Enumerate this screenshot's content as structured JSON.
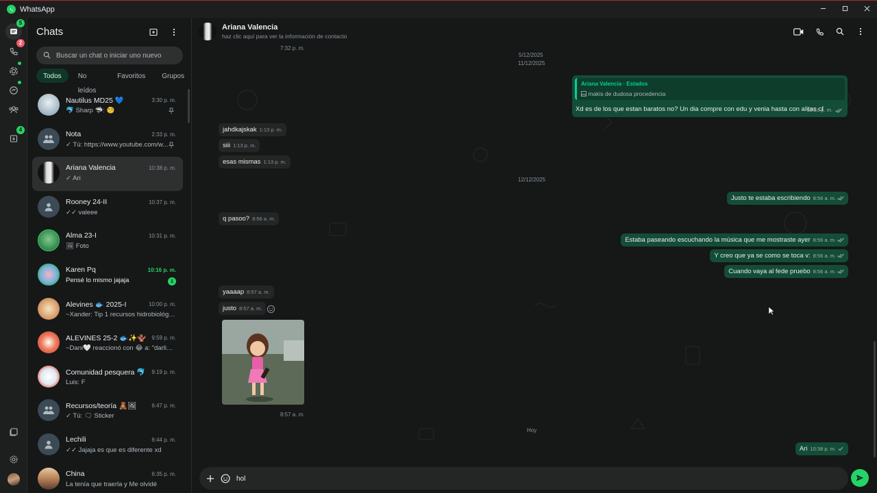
{
  "window": {
    "app_name": "WhatsApp"
  },
  "rail": {
    "chats_badge": "5",
    "calls_badge": "2",
    "communities_badge": "4",
    "badge_color": "#25d366",
    "calls_badge_color": "#f15c6d"
  },
  "chatlist": {
    "title": "Chats",
    "search_placeholder": "Buscar un chat o iniciar uno nuevo",
    "filters": [
      "Todos",
      "No leídos",
      "Favoritos",
      "Grupos"
    ],
    "rows": [
      {
        "name": "Nautilus MD25 💙",
        "time": "3:30 p. m.",
        "preview": "🐬 Sharp 🦈: 🧐",
        "pinned": true
      },
      {
        "name": "Nota",
        "time": "2:33 p. m.",
        "preview": "✓ Tú: https://www.youtube.com/w...",
        "pinned": true
      },
      {
        "name": "Ariana Valencia",
        "time": "10:38 p. m.",
        "preview": "✓ Ari"
      },
      {
        "name": "Rooney 24-II",
        "time": "10:37 p. m.",
        "preview": "✓✓ valeee"
      },
      {
        "name": "Alma 23-I",
        "time": "10:31 p. m.",
        "preview": "🖼 Foto"
      },
      {
        "name": "Karen Pq",
        "time": "10:16 p. m.",
        "preview": "Pensé lo mismo jajaja",
        "unread": "1"
      },
      {
        "name": "Alevines 🐟 2025-I",
        "time": "10:00 p. m.",
        "preview": "~Xander: Tip 1 recursos hidrobiológicos"
      },
      {
        "name": "ALEVINES 25-2 🐟✨🪸",
        "time": "9:59 p. m.",
        "preview": "~Dani🤍 reaccionó con 😂 a: \"darlines\""
      },
      {
        "name": "Comunidad pesquera 🐬",
        "time": "9:19 p. m.",
        "preview": "Luis: F"
      },
      {
        "name": "Recursos/teoría 🧸🖼",
        "time": "6:47 p. m.",
        "preview": "✓ Tú: 🗨 Sticker"
      },
      {
        "name": "Lechili",
        "time": "6:44 p. m.",
        "preview": "✓✓ Jajaja es que es diferente xd"
      },
      {
        "name": "China",
        "time": "6:35 p. m.",
        "preview": "La tenía que traerla y  Me olvidé"
      }
    ]
  },
  "conversation": {
    "contact_name": "Ariana Valencia",
    "contact_sub": "haz clic aquí para ver la información de contacto",
    "top_time": "7:32 p. m.",
    "dates": [
      "5/12/2025",
      "11/12/2025",
      "12/12/2025",
      "Hoy"
    ],
    "reply": {
      "author": "Ariana Valencia · Estados",
      "quoted": "makis de dudosa procedencia",
      "text": "Xd es de los que estan baratos no? Un dia compre con edu y venia hasta con alitas cf",
      "time": "12:53 p. m."
    },
    "messages": [
      {
        "text": "jahdkajskak",
        "time": "1:13 p. m.",
        "dir": "in"
      },
      {
        "text": "siii",
        "time": "1:13 p. m.",
        "dir": "in"
      },
      {
        "text": "esas mismas",
        "time": "1:13 p. m.",
        "dir": "in"
      },
      {
        "text": "Justo te estaba escribiendo",
        "time": "8:56 a. m.",
        "dir": "out"
      },
      {
        "text": "q pasoo?",
        "time": "8:56 a. m.",
        "dir": "in"
      },
      {
        "text": "Estaba paseando escuchando la música que me mostraste ayer",
        "time": "8:56 a. m.",
        "dir": "out"
      },
      {
        "text": "Y creo que ya se como se toca v:",
        "time": "8:56 a. m.",
        "dir": "out"
      },
      {
        "text": "Cuando vaya al fede pruebo",
        "time": "8:56 a. m.",
        "dir": "out"
      },
      {
        "text": "yaaaap",
        "time": "8:57 a. m.",
        "dir": "in"
      },
      {
        "text": "justo",
        "time": "8:57 a. m.",
        "dir": "in"
      },
      {
        "text": "Ari",
        "time": "10:38 p. m.",
        "dir": "out"
      }
    ],
    "sticker_time": "8:57 a. m.",
    "composer_value": "hol"
  }
}
